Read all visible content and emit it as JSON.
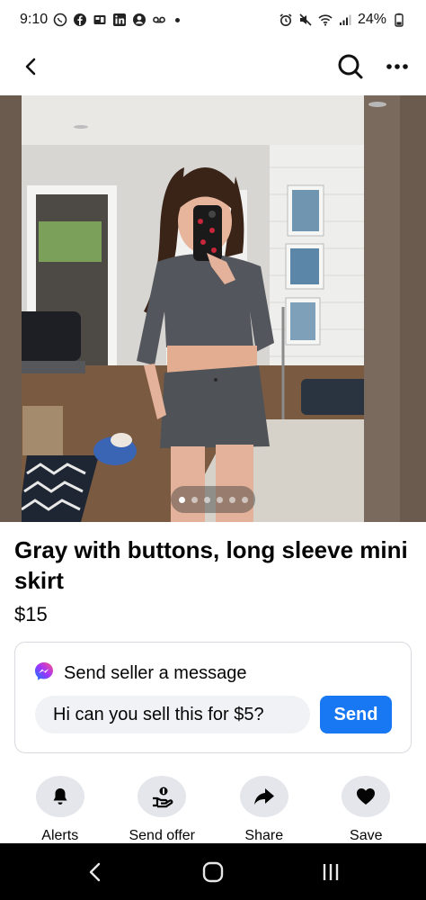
{
  "status_bar": {
    "time": "9:10",
    "battery": "24%",
    "left_icons": [
      "whatsapp-icon",
      "facebook-icon",
      "sim-icon",
      "linkedin-icon",
      "account-icon",
      "voicemail-icon"
    ],
    "right_icons": [
      "alarm-icon",
      "mute-icon",
      "wifi-icon",
      "signal-icon",
      "battery-icon"
    ]
  },
  "header": {
    "back_icon": "back-arrow-icon",
    "search_icon": "search-icon",
    "more_icon": "more-icon"
  },
  "photo": {
    "dot_count": 6,
    "active_index": 0
  },
  "listing": {
    "title": "Gray with buttons, long sleeve mini skirt",
    "price": "$15"
  },
  "message": {
    "heading": "Send seller a message",
    "input_value": "Hi can you sell this for $5?",
    "send_label": "Send"
  },
  "actions": [
    {
      "label": "Alerts",
      "icon": "bell-icon"
    },
    {
      "label": "Send offer",
      "icon": "offer-icon"
    },
    {
      "label": "Share",
      "icon": "share-icon"
    },
    {
      "label": "Save",
      "icon": "heart-icon"
    }
  ],
  "colors": {
    "accent": "#1877f2",
    "chip_bg": "#e4e6eb",
    "input_bg": "#f0f2f5"
  }
}
